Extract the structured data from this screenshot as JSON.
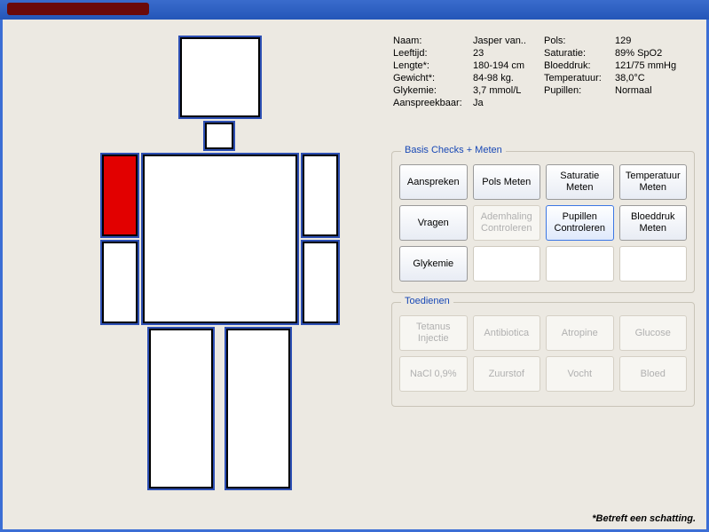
{
  "patient": {
    "labels": {
      "naam": "Naam:",
      "leeftijd": "Leeftijd:",
      "lengte": "Lengte*:",
      "gewicht": "Gewicht*:",
      "glykemie": "Glykemie:",
      "aanspreekbaar": "Aanspreekbaar:",
      "pols": "Pols:",
      "saturatie": "Saturatie:",
      "bloeddruk": "Bloeddruk:",
      "temperatuur": "Temperatuur:",
      "pupillen": "Pupillen:"
    },
    "values": {
      "naam": "Jasper van..",
      "leeftijd": "23",
      "lengte": "180-194 cm",
      "gewicht": "84-98 kg.",
      "glykemie": "3,7 mmol/L",
      "aanspreekbaar": "Ja",
      "pols": "129",
      "saturatie": "89% SpO2",
      "bloeddruk": "121/75 mmHg",
      "temperatuur": "38,0°C",
      "pupillen": "Normaal"
    }
  },
  "body": {
    "injured_part": "right-upper-arm"
  },
  "groups": {
    "checks": {
      "title": "Basis Checks + Meten",
      "buttons": {
        "aanspreken": "Aanspreken",
        "pols": "Pols Meten",
        "saturatie": "Saturatie Meten",
        "temperatuur": "Temperatuur Meten",
        "vragen": "Vragen",
        "ademhaling": "Ademhaling Controleren",
        "pupillen": "Pupillen Controleren",
        "bloeddruk": "Bloeddruk Meten",
        "glykemie": "Glykemie"
      }
    },
    "admin": {
      "title": "Toedienen",
      "buttons": {
        "tetanus": "Tetanus Injectie",
        "antibiotica": "Antibiotica",
        "atropine": "Atropine",
        "glucose": "Glucose",
        "nacl": "NaCl 0,9%",
        "zuurstof": "Zuurstof",
        "vocht": "Vocht",
        "bloed": "Bloed"
      }
    }
  },
  "footnote": "*Betreft een schatting."
}
